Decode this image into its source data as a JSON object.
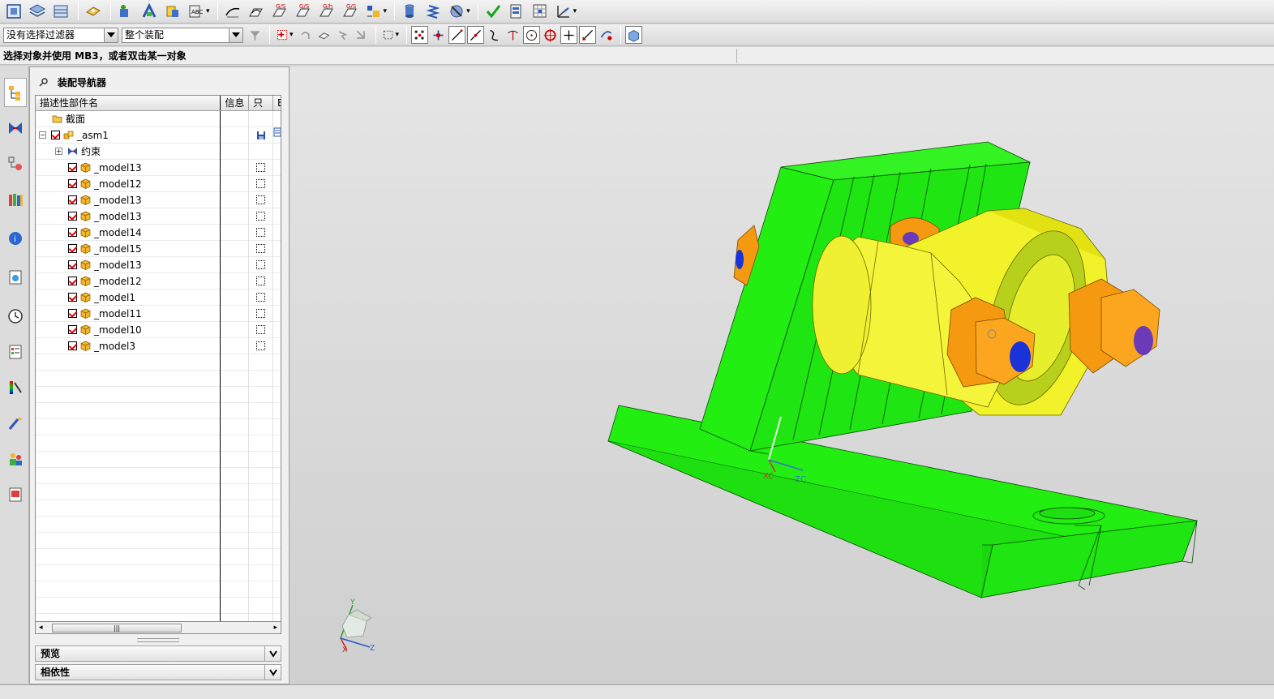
{
  "filters": {
    "selection_filter": "没有选择过滤器",
    "scope": "整个装配"
  },
  "cue_line": "选择对象并使用 MB3，或者双击某一对象",
  "navigator": {
    "title": "装配导航器",
    "columns": [
      "描述性部件名",
      "信息",
      "只",
      "E"
    ],
    "rows": [
      {
        "label": "截面",
        "level": 0,
        "type": "folder"
      },
      {
        "label": "_asm1",
        "level": 0,
        "type": "assembly"
      },
      {
        "label": "约束",
        "level": 1,
        "type": "constraint"
      },
      {
        "label": "_model13",
        "level": 1,
        "type": "part"
      },
      {
        "label": "_model12",
        "level": 1,
        "type": "part"
      },
      {
        "label": "_model13",
        "level": 1,
        "type": "part"
      },
      {
        "label": "_model13",
        "level": 1,
        "type": "part"
      },
      {
        "label": "_model14",
        "level": 1,
        "type": "part"
      },
      {
        "label": "_model15",
        "level": 1,
        "type": "part"
      },
      {
        "label": "_model13",
        "level": 1,
        "type": "part"
      },
      {
        "label": "_model12",
        "level": 1,
        "type": "part"
      },
      {
        "label": "_model1",
        "level": 1,
        "type": "part"
      },
      {
        "label": "_model11",
        "level": 1,
        "type": "part"
      },
      {
        "label": "_model10",
        "level": 1,
        "type": "part"
      },
      {
        "label": "_model3",
        "level": 1,
        "type": "part"
      }
    ],
    "panels": {
      "preview": "预览",
      "dependency": "相依性"
    }
  },
  "viewport": {
    "wcs_x": "XC",
    "wcs_z": "ZC",
    "triad_x": "X",
    "triad_y": "Y",
    "triad_z": "Z"
  },
  "icons": {
    "toolbar1": [
      "fit-icon",
      "layers-icon",
      "view-icon",
      "assembly-icon",
      "add-component-icon",
      "constraint-icon",
      "move-icon",
      "explode-icon",
      "sketch-icon",
      "curve-icon",
      "surface-icon",
      "mesh-icon",
      "blend-icon",
      "copy-icon",
      "database-icon",
      "spring-icon",
      "motion-icon",
      "check-icon",
      "attribute-icon",
      "clearance-icon",
      "wcs-icon"
    ],
    "toolbar2": [
      "filter-icon",
      "select-icon",
      "undo-select-icon",
      "feature-icon",
      "region-icon",
      "box-select-icon",
      "snap-icon",
      "point-icon",
      "line-icon",
      "arc-icon",
      "curve-snap-icon",
      "tangent-icon",
      "circle-icon",
      "center-icon",
      "cross-icon",
      "end-icon",
      "quadrant-icon",
      "bodies-icon"
    ]
  },
  "colors": {
    "green": "#22ee11",
    "yellow": "#f2f22a",
    "orange": "#f59a10",
    "blue": "#1a33d8",
    "purple": "#6a3ab8"
  }
}
